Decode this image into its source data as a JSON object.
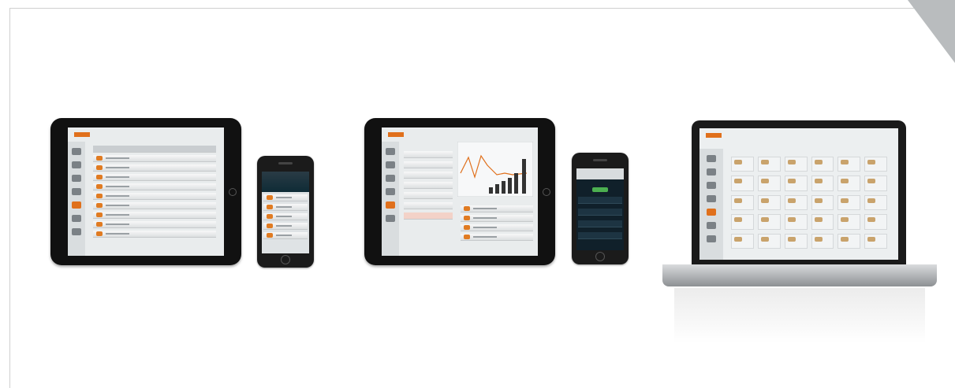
{
  "devices": [
    {
      "kind": "tablet",
      "screen": "equipment-list"
    },
    {
      "kind": "smartphone",
      "screen": "equipment-list"
    },
    {
      "kind": "tablet",
      "screen": "dashboard-chart"
    },
    {
      "kind": "smartphone",
      "screen": "dashboard"
    },
    {
      "kind": "laptop",
      "screen": "equipment-grid"
    }
  ],
  "colors": {
    "accent": "#e0701c",
    "frame": "#cfcfcf",
    "bezel": "#111111"
  }
}
